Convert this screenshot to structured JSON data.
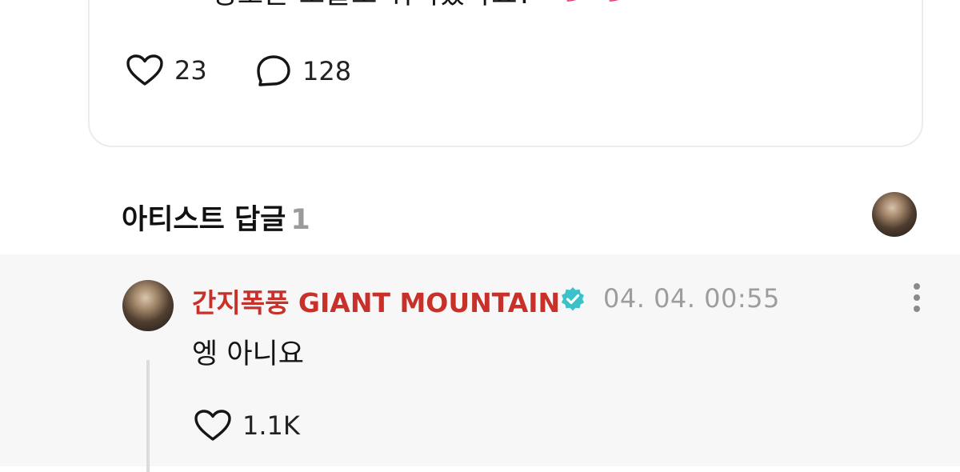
{
  "post": {
    "text": "성호는 오늘도 귀여웠나요?",
    "emoji": "💕 💕",
    "like_count": "23",
    "comment_count": "128"
  },
  "artist_replies": {
    "title": "아티스트 답글",
    "count": "1"
  },
  "reply": {
    "author": "간지폭풍 GIANT MOUNTAIN",
    "verified": true,
    "timestamp": "04. 04. 00:55",
    "text": "엥 아니요",
    "like_count": "1.1K"
  },
  "colors": {
    "author_red": "#c8302a",
    "verified_teal": "#3cc0c9",
    "muted_gray": "#9d9d9d",
    "reply_bg": "#f7f7f7"
  },
  "icons": [
    "heart-icon",
    "comment-bubble-icon",
    "verified-badge-icon",
    "more-vertical-icon"
  ]
}
